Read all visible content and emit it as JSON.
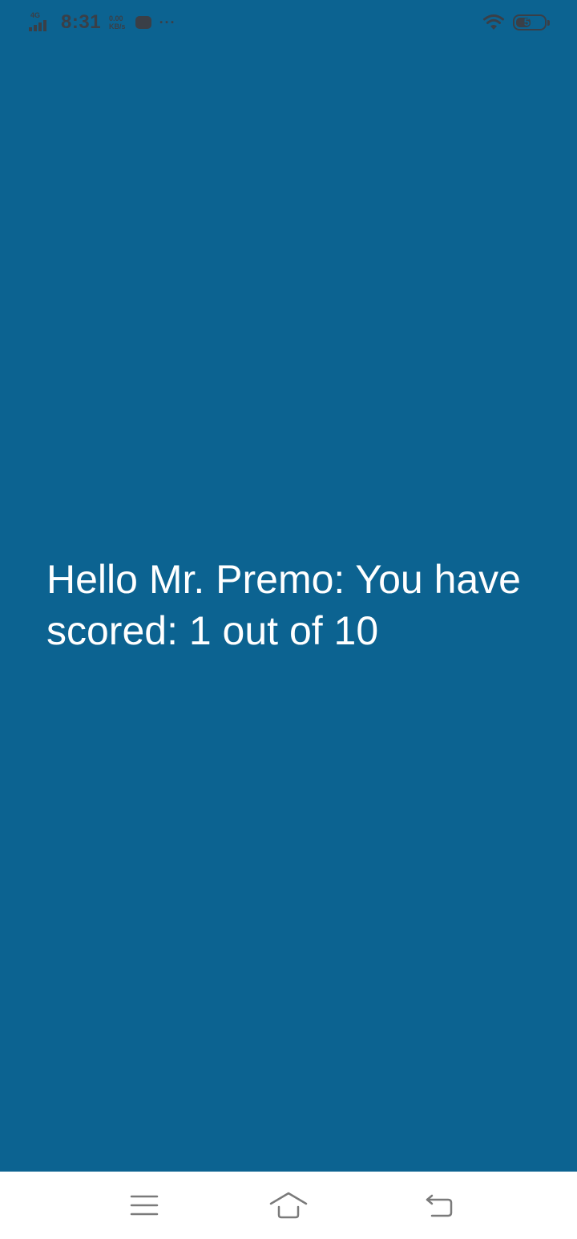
{
  "status_bar": {
    "network_type": "4G",
    "time": "8:31",
    "speed_value": "0.00",
    "speed_unit": "KB/s",
    "battery_level": "57",
    "icons": [
      "signal-icon",
      "message-icon",
      "more-icon",
      "wifi-icon",
      "battery-icon"
    ]
  },
  "main": {
    "message": "Hello Mr. Premo: You have scored: 1 out of 10"
  },
  "nav_bar": {
    "icons": [
      "menu-icon",
      "home-icon",
      "back-icon"
    ]
  },
  "colors": {
    "background": "#0c6391",
    "text": "#ffffff",
    "status_icons": "#3a3f47",
    "nav_bar": "#ffffff",
    "nav_icons": "#7a7a7a"
  }
}
